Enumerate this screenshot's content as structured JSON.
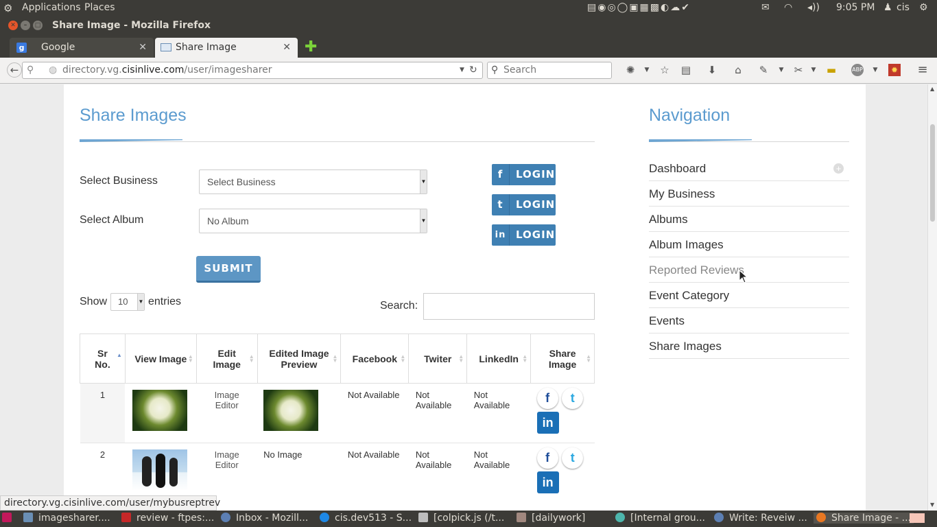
{
  "system": {
    "applications": "Applications",
    "places": "Places",
    "clock": "9:05 PM",
    "user": "cis"
  },
  "window": {
    "title": "Share Image - Mozilla Firefox"
  },
  "tabs": [
    {
      "label": "Google"
    },
    {
      "label": "Share Image"
    }
  ],
  "address": {
    "url_prefix": "directory.vg.",
    "url_domain": "cisinlive.com",
    "url_path": "/user/imagesharer",
    "search_placeholder": "Search"
  },
  "main": {
    "title": "Share Images",
    "select_business_label": "Select Business",
    "select_business_value": "Select Business",
    "select_album_label": "Select Album",
    "select_album_value": "No Album",
    "login_label": "LOGIN",
    "submit_label": "SUBMIT",
    "show_label": "Show",
    "entries_value": "10",
    "entries_label": "entries",
    "search_label": "Search:",
    "columns": [
      "Sr No.",
      "View Image",
      "Edit Image",
      "Edited Image Preview",
      "Facebook",
      "Twiter",
      "LinkedIn",
      "Share Image"
    ],
    "rows": [
      {
        "sr": "1",
        "edit": "Image Editor",
        "preview": "",
        "facebook": "Not Available",
        "twitter": "Not Available",
        "linkedin": "Not Available"
      },
      {
        "sr": "2",
        "edit": "Image Editor",
        "preview": "No Image",
        "facebook": "Not Available",
        "twitter": "Not Available",
        "linkedin": "Not Available"
      }
    ]
  },
  "sidebar": {
    "title": "Navigation",
    "items": [
      {
        "label": "Dashboard"
      },
      {
        "label": "My Business"
      },
      {
        "label": "Albums"
      },
      {
        "label": "Album Images"
      },
      {
        "label": "Reported Reviews"
      },
      {
        "label": "Event Category"
      },
      {
        "label": "Events"
      },
      {
        "label": "Share Images"
      }
    ]
  },
  "status": {
    "link": "directory.vg.cisinlive.com/user/mybusreptrev"
  },
  "taskbar": [
    {
      "label": "imagesharer...."
    },
    {
      "label": "review - ftpes:..."
    },
    {
      "label": "Inbox - Mozill..."
    },
    {
      "label": "cis.dev513 - S..."
    },
    {
      "label": "[colpick.js (/t..."
    },
    {
      "label": "[dailywork]"
    },
    {
      "label": "[Internal grou..."
    },
    {
      "label": "Write: Reveiw ..."
    },
    {
      "label": "Share Image - ..."
    }
  ],
  "colors": {
    "accent": "#5b9bcf",
    "button": "#3f80b3",
    "chrome": "#3c3b37"
  }
}
